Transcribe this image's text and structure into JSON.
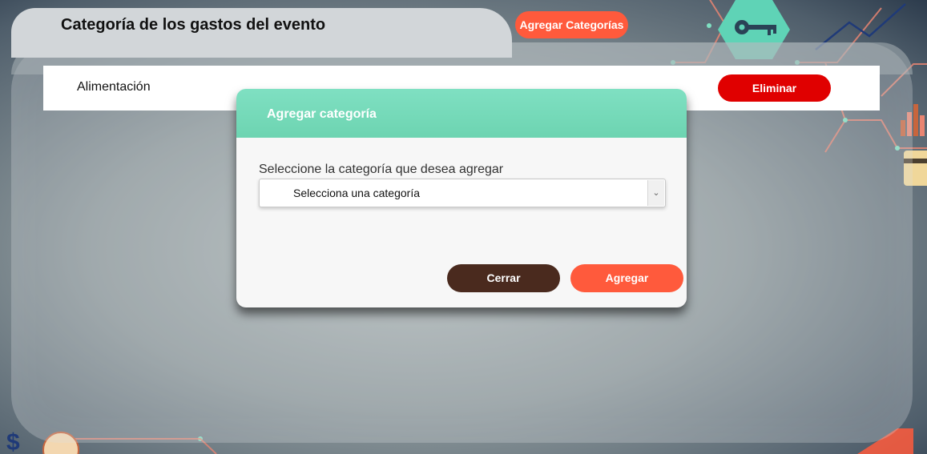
{
  "header": {
    "title": "Categoría de los gastos del evento",
    "add_categories_label": "Agregar Categorías"
  },
  "categories": [
    {
      "name": "Alimentación",
      "delete_label": "Eliminar"
    }
  ],
  "modal": {
    "title": "Agregar categoría",
    "prompt": "Seleccione la categoría que desea agregar",
    "select_value": "Selecciona una categoría",
    "close_label": "Cerrar",
    "add_label": "Agregar"
  },
  "colors": {
    "accent_orange": "#ff5a3c",
    "danger_red": "#e00000",
    "modal_header": "#7fe0c2",
    "close_brown": "#4a2a1e"
  },
  "icons": {
    "decor": [
      "key-icon",
      "bar-chart-icon",
      "credit-card-icon",
      "dollar-icon",
      "globe-icon"
    ]
  }
}
